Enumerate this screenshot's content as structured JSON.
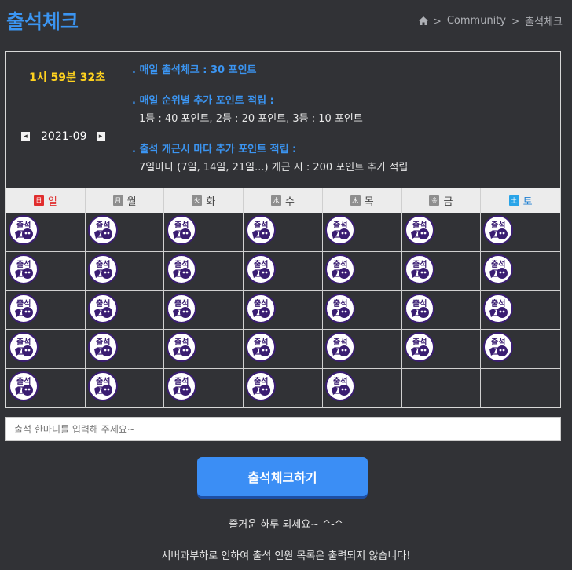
{
  "page": {
    "title": "출석체크",
    "breadcrumb": {
      "home_icon": "home-icon",
      "items": [
        "Community",
        "출석체크"
      ]
    }
  },
  "panel": {
    "clock": "1시 59분 32초",
    "month": "2021-09",
    "prev_arrow": "◂",
    "next_arrow": "▸",
    "info": [
      {
        "heading": ". 매일 출석체크 : 30 포인트",
        "sub": ""
      },
      {
        "heading": ". 매일 순위별 추가 포인트 적립 :",
        "sub": "1등 : 40 포인트,   2등 : 20 포인트,   3등 : 10 포인트"
      },
      {
        "heading": ". 출석 개근시 마다 추가 포인트 적립 :",
        "sub": "7일마다 (7일, 14일, 21일...) 개근 시 : 200 포인트 추가 적립"
      }
    ]
  },
  "calendar": {
    "days": [
      {
        "char": "日",
        "label": "일"
      },
      {
        "char": "月",
        "label": "월"
      },
      {
        "char": "火",
        "label": "화"
      },
      {
        "char": "水",
        "label": "수"
      },
      {
        "char": "木",
        "label": "목"
      },
      {
        "char": "金",
        "label": "금"
      },
      {
        "char": "土",
        "label": "토"
      }
    ],
    "stamp_icon": "attendance-stamp-icon",
    "stamp_count": 33
  },
  "comment": {
    "placeholder": "출석 한마디를 입력해 주세요~"
  },
  "button": {
    "label": "출석체크하기"
  },
  "messages": [
    "즐거운 하루 되세요~ ^-^",
    "서버과부하로 인하여 출석 인원 목록은 출력되지 않습니다!"
  ],
  "colors": {
    "accent": "#3b95f2",
    "clock": "#ffd21f",
    "background": "#313236",
    "button": "#3b8ef5"
  }
}
